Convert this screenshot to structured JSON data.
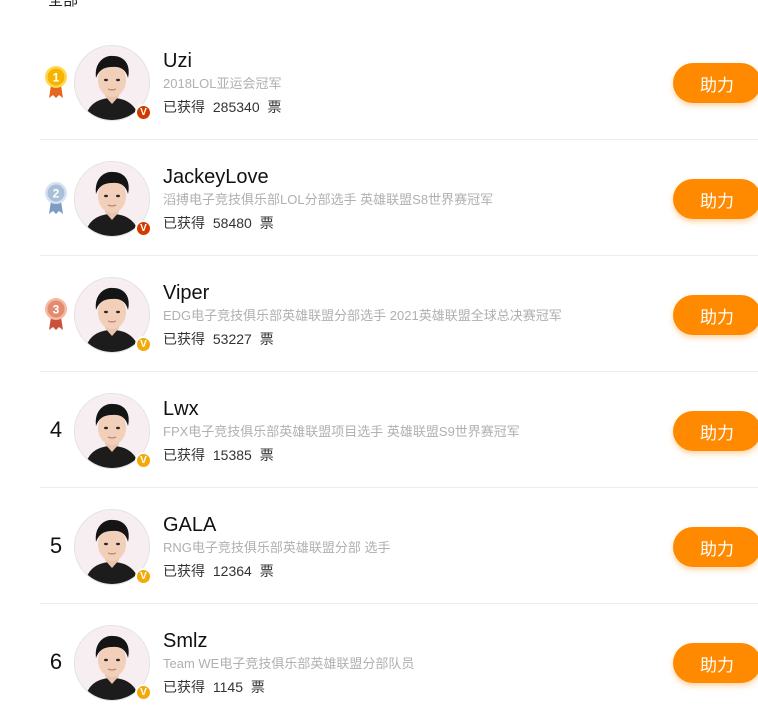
{
  "header": {
    "label": "全部"
  },
  "colors": {
    "accent": "#ff8a00",
    "badge_red": "#d23a00",
    "badge_gold": "#f2a90a"
  },
  "players": [
    {
      "rank": "1",
      "medal": "gold",
      "name": "Uzi",
      "desc": "2018LOL亚运会冠军",
      "votes_label": "已获得",
      "votes": "285340",
      "unit": "票",
      "badge": "V",
      "badge_color": "#d23a00",
      "button": "助力"
    },
    {
      "rank": "2",
      "medal": "silver",
      "name": "JackeyLove",
      "desc": "滔搏电子竞技俱乐部LOL分部选手 英雄联盟S8世界赛冠军",
      "votes_label": "已获得",
      "votes": "58480",
      "unit": "票",
      "badge": "V",
      "badge_color": "#d23a00",
      "button": "助力"
    },
    {
      "rank": "3",
      "medal": "bronze",
      "name": "Viper",
      "desc": "EDG电子竞技俱乐部英雄联盟分部选手 2021英雄联盟全球总决赛冠军",
      "votes_label": "已获得",
      "votes": "53227",
      "unit": "票",
      "badge": "V",
      "badge_color": "#f2a90a",
      "button": "助力"
    },
    {
      "rank": "4",
      "medal": "",
      "name": "Lwx",
      "desc": "FPX电子竞技俱乐部英雄联盟项目选手 英雄联盟S9世界赛冠军",
      "votes_label": "已获得",
      "votes": "15385",
      "unit": "票",
      "badge": "V",
      "badge_color": "#f2a90a",
      "button": "助力"
    },
    {
      "rank": "5",
      "medal": "",
      "name": "GALA",
      "desc": "RNG电子竞技俱乐部英雄联盟分部 选手",
      "votes_label": "已获得",
      "votes": "12364",
      "unit": "票",
      "badge": "V",
      "badge_color": "#f2a90a",
      "button": "助力"
    },
    {
      "rank": "6",
      "medal": "",
      "name": "Smlz",
      "desc": "Team WE电子竞技俱乐部英雄联盟分部队员",
      "votes_label": "已获得",
      "votes": "1145",
      "unit": "票",
      "badge": "V",
      "badge_color": "#f2a90a",
      "button": "助力"
    }
  ]
}
